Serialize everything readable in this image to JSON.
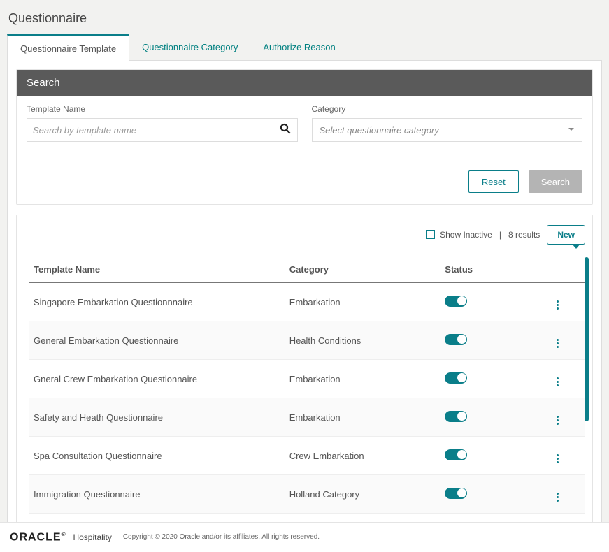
{
  "page_title": "Questionnaire",
  "tabs": [
    {
      "label": "Questionnaire Template",
      "active": true
    },
    {
      "label": "Questionnaire Category",
      "active": false
    },
    {
      "label": "Authorize Reason",
      "active": false
    }
  ],
  "search": {
    "header": "Search",
    "template_label": "Template Name",
    "template_placeholder": "Search by template name",
    "category_label": "Category",
    "category_placeholder": "Select questionnaire category",
    "reset_label": "Reset",
    "search_label": "Search"
  },
  "results": {
    "show_inactive_label": "Show Inactive",
    "count_text": "8 results",
    "new_label": "New",
    "columns": {
      "name": "Template Name",
      "category": "Category",
      "status": "Status"
    },
    "rows": [
      {
        "name": "Singapore Embarkation Questionnnaire",
        "category": "Embarkation",
        "active": true
      },
      {
        "name": "General Embarkation Questionnaire",
        "category": "Health Conditions",
        "active": true
      },
      {
        "name": "Gneral Crew Embarkation Questionnaire",
        "category": "Embarkation",
        "active": true
      },
      {
        "name": "Safety and Heath Questionnaire",
        "category": "Embarkation",
        "active": true
      },
      {
        "name": "Spa Consultation Questionnaire",
        "category": "Crew Embarkation",
        "active": true
      },
      {
        "name": "Immigration Questionnaire",
        "category": "Holland Category",
        "active": true
      }
    ]
  },
  "footer": {
    "brand_main": "ORACLE",
    "brand_sub": "Hospitality",
    "copyright": "Copyright © 2020 Oracle and/or its affiliates. All rights reserved."
  }
}
